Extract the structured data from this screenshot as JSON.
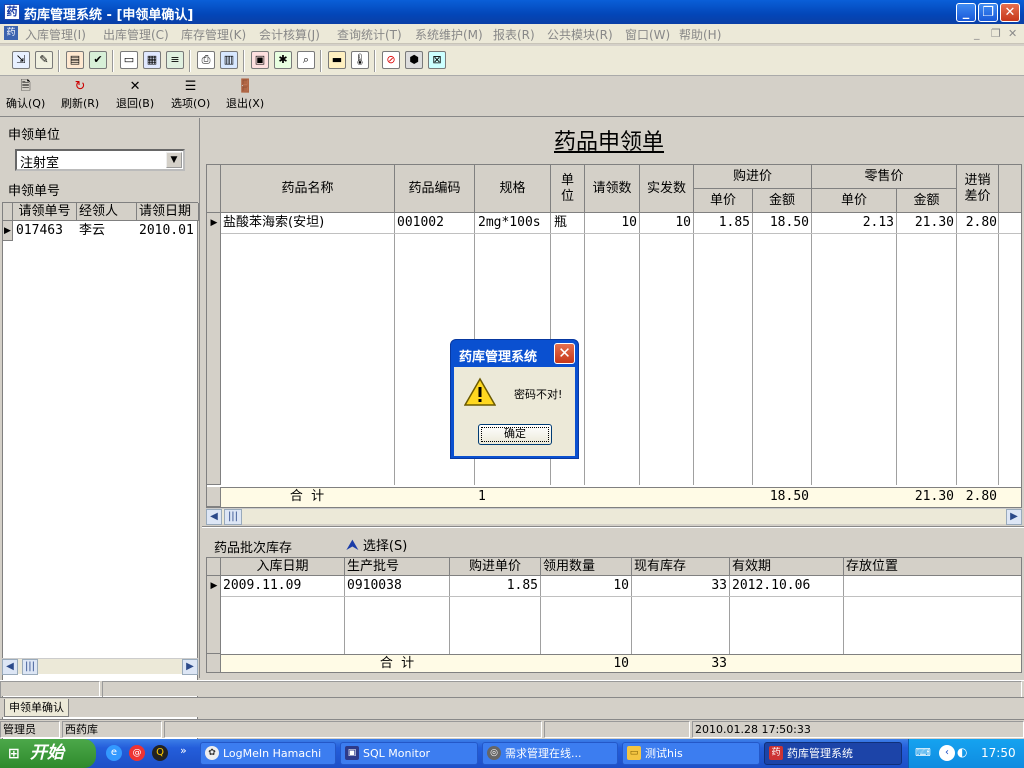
{
  "window": {
    "title": "药库管理系统 - [申领单确认]"
  },
  "menu": {
    "items": [
      "入库管理(I)",
      "出库管理(C)",
      "库存管理(K)",
      "会计核算(J)",
      "查询统计(T)",
      "系统维护(M)",
      "报表(R)",
      "公共模块(R)",
      "窗口(W)",
      "帮助(H)"
    ]
  },
  "actions": [
    {
      "label": "确认(Q)",
      "icon": "confirm-doc-icon"
    },
    {
      "label": "刷新(R)",
      "icon": "refresh-icon"
    },
    {
      "label": "退回(B)",
      "icon": "return-x-icon"
    },
    {
      "label": "选项(O)",
      "icon": "options-icon"
    },
    {
      "label": "退出(X)",
      "icon": "exit-door-icon"
    }
  ],
  "left": {
    "unit_label": "申领单位",
    "unit_value": "注射室",
    "order_label": "申领单号",
    "columns": [
      "请领单号",
      "经领人",
      "请领日期"
    ],
    "rows": [
      {
        "no": "017463",
        "person": "李云",
        "date": "2010.01"
      }
    ]
  },
  "main": {
    "title": "药品申领单",
    "headers": {
      "name": "药品名称",
      "code": "药品编码",
      "spec": "规格",
      "unit": "单位",
      "req_qty": "请领数",
      "actual_qty": "实发数",
      "purchase": "购进价",
      "retail": "零售价",
      "unit_price": "单价",
      "amount": "金额",
      "diff": "进销差价"
    },
    "rows": [
      {
        "name": "盐酸苯海索(安坦)",
        "code": "001002",
        "spec": "2mg*100s",
        "unit": "瓶",
        "req_qty": "10",
        "actual_qty": "10",
        "p_price": "1.85",
        "p_amount": "18.50",
        "r_price": "2.13",
        "r_amount": "21.30",
        "diff": "2.80"
      }
    ],
    "total": {
      "label": "合  计",
      "spec": "1",
      "p_amount": "18.50",
      "r_amount": "21.30",
      "diff": "2.80"
    }
  },
  "batch": {
    "label": "药品批次库存",
    "select_label": "选择(S)",
    "columns": [
      "入库日期",
      "生产批号",
      "购进单价",
      "领用数量",
      "现有库存",
      "有效期",
      "存放位置"
    ],
    "rows": [
      {
        "date": "2009.11.09",
        "batch_no": "0910038",
        "price": "1.85",
        "qty": "10",
        "stock": "33",
        "expiry": "2012.10.06",
        "location": ""
      }
    ],
    "total": {
      "label": "合  计",
      "qty": "10",
      "stock": "33"
    }
  },
  "dialog": {
    "title": "药库管理系统",
    "message": "密码不对!",
    "ok": "确定"
  },
  "tab": {
    "label": "申领单确认"
  },
  "status": {
    "user": "管理员",
    "dept": "西药库",
    "datetime": "2010.01.28 17:50:33"
  },
  "taskbar": {
    "start": "开始",
    "tasks": [
      "LogMeIn Hamachi",
      "SQL Monitor",
      "需求管理在线...",
      "测试his",
      "药库管理系统"
    ],
    "clock": "17:50"
  }
}
